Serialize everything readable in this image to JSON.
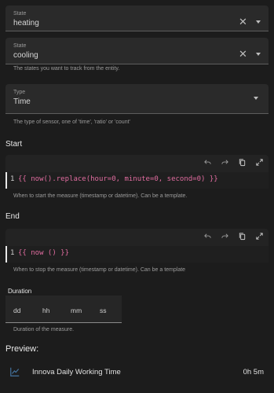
{
  "state_fields": [
    {
      "label": "State",
      "value": "heating"
    },
    {
      "label": "State",
      "value": "cooling"
    }
  ],
  "states_helper": "The states you want to track from the entity.",
  "type_field": {
    "label": "Type",
    "value": "Time"
  },
  "type_helper": "The type of sensor, one of 'time', 'ratio' or 'count'",
  "start": {
    "title": "Start",
    "line_number": "1",
    "code": "{{ now().replace(hour=0, minute=0, second=0) }}",
    "helper": "When to start the measure (timestamp or datetime). Can be a template."
  },
  "end": {
    "title": "End",
    "line_number": "1",
    "code": "{{ now () }}",
    "helper": "When to stop the measure (timestamp or datetime). Can be a template"
  },
  "duration": {
    "title": "Duration",
    "fields": [
      "dd",
      "hh",
      "mm",
      "ss"
    ],
    "helper": "Duration of the measure."
  },
  "preview": {
    "title": "Preview:",
    "entity_name": "Innova Daily Working Time",
    "entity_value": "0h 5m",
    "icon": "chart-line-icon"
  },
  "colors": {
    "background": "#1c1c1c",
    "field_bg": "#2a2a2a",
    "code_pink": "#e06c9f",
    "icon_blue": "#44739e"
  }
}
